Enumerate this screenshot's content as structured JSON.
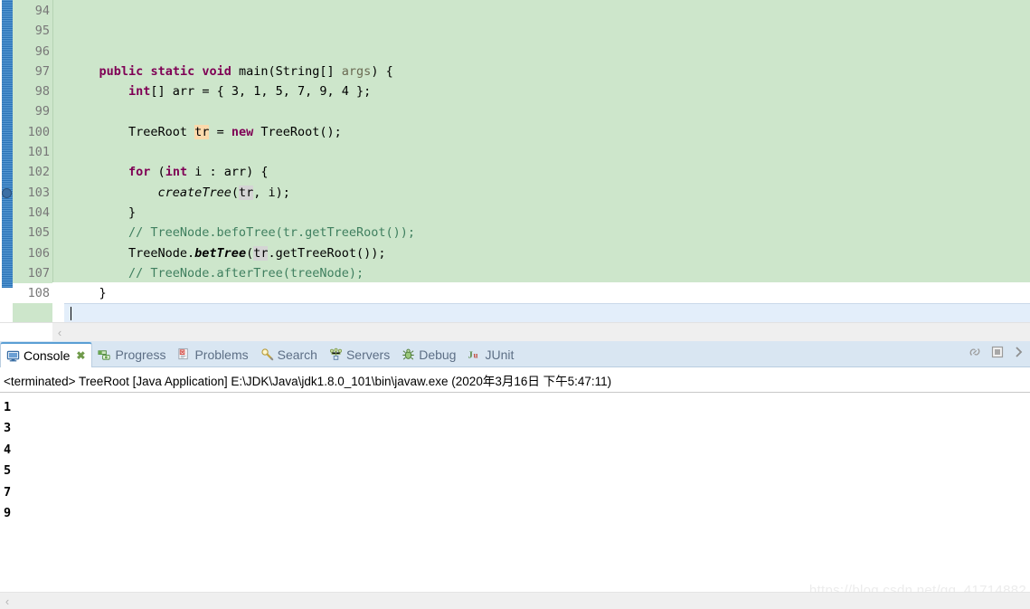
{
  "editor": {
    "first_visible_line": 94,
    "current_line": 106,
    "breakpoint_line": 103,
    "fold_marker_line": 94,
    "lines": [
      {
        "num": "94",
        "segments": [
          {
            "t": "    ",
            "c": ""
          },
          {
            "t": "public",
            "c": "kw"
          },
          {
            "t": " ",
            "c": ""
          },
          {
            "t": "static",
            "c": "kw"
          },
          {
            "t": " ",
            "c": ""
          },
          {
            "t": "void",
            "c": "kw"
          },
          {
            "t": " main(String[] ",
            "c": ""
          },
          {
            "t": "args",
            "c": "param"
          },
          {
            "t": ") {",
            "c": ""
          }
        ]
      },
      {
        "num": "95",
        "segments": [
          {
            "t": "        ",
            "c": ""
          },
          {
            "t": "int",
            "c": "kw"
          },
          {
            "t": "[] arr = { 3, 1, 5, 7, 9, 4 };",
            "c": ""
          }
        ]
      },
      {
        "num": "96",
        "segments": []
      },
      {
        "num": "97",
        "segments": [
          {
            "t": "        TreeRoot ",
            "c": ""
          },
          {
            "t": "tr",
            "c": "occ-write"
          },
          {
            "t": " = ",
            "c": ""
          },
          {
            "t": "new",
            "c": "kw"
          },
          {
            "t": " TreeRoot();",
            "c": ""
          }
        ]
      },
      {
        "num": "98",
        "segments": []
      },
      {
        "num": "99",
        "segments": [
          {
            "t": "        ",
            "c": ""
          },
          {
            "t": "for",
            "c": "kw"
          },
          {
            "t": " (",
            "c": ""
          },
          {
            "t": "int",
            "c": "kw"
          },
          {
            "t": " i : arr) {",
            "c": ""
          }
        ]
      },
      {
        "num": "100",
        "segments": [
          {
            "t": "            ",
            "c": ""
          },
          {
            "t": "createTree",
            "c": "stat-m"
          },
          {
            "t": "(",
            "c": ""
          },
          {
            "t": "tr",
            "c": "occ-read"
          },
          {
            "t": ", i);",
            "c": ""
          }
        ]
      },
      {
        "num": "101",
        "segments": [
          {
            "t": "        }",
            "c": ""
          }
        ]
      },
      {
        "num": "102",
        "segments": [
          {
            "t": "        // TreeNode.befoTree(tr.getTreeRoot());",
            "c": "cmt"
          }
        ]
      },
      {
        "num": "103",
        "segments": [
          {
            "t": "        TreeNode.",
            "c": ""
          },
          {
            "t": "betTree",
            "c": "stat-mb"
          },
          {
            "t": "(",
            "c": ""
          },
          {
            "t": "tr",
            "c": "occ-read"
          },
          {
            "t": ".getTreeRoot());",
            "c": ""
          }
        ]
      },
      {
        "num": "104",
        "segments": [
          {
            "t": "        // TreeNode.afterTree(treeNode);",
            "c": "cmt"
          }
        ]
      },
      {
        "num": "105",
        "segments": [
          {
            "t": "    }",
            "c": ""
          }
        ]
      },
      {
        "num": "106",
        "segments": [],
        "current": true
      },
      {
        "num": "107",
        "segments": [
          {
            "t": "}",
            "c": ""
          }
        ]
      },
      {
        "num": "108",
        "segments": [],
        "tail": true
      }
    ],
    "scroll_left_arrow": "‹"
  },
  "console_view": {
    "tabs": [
      {
        "label": "Console",
        "icon": "console-icon",
        "active": true,
        "close": "✖"
      },
      {
        "label": "Progress",
        "icon": "progress-icon",
        "active": false
      },
      {
        "label": "Problems",
        "icon": "problems-icon",
        "active": false
      },
      {
        "label": "Search",
        "icon": "search-icon",
        "active": false
      },
      {
        "label": "Servers",
        "icon": "servers-icon",
        "active": false
      },
      {
        "label": "Debug",
        "icon": "debug-icon",
        "active": false
      },
      {
        "label": "JUnit",
        "icon": "junit-icon",
        "active": false
      }
    ],
    "toolbar": [
      {
        "name": "pin-console-icon"
      },
      {
        "name": "terminate-icon"
      },
      {
        "name": "view-menu-chevron-icon"
      }
    ],
    "header_line": "<terminated> TreeRoot [Java Application] E:\\JDK\\Java\\jdk1.8.0_101\\bin\\javaw.exe (2020年3月16日 下午5:47:11)",
    "output_lines": [
      "1",
      "3",
      "4",
      "5",
      "7",
      "9"
    ],
    "scroll_left_arrow": "‹"
  },
  "watermark": "https://blog.csdn.net/qq_41714882",
  "colors": {
    "editor_background": "#cde6cb",
    "current_line": "#e3eefa",
    "keyword": "#7f0055",
    "comment": "#3f7f5f",
    "parameter": "#6a6a52",
    "occurrence_read": "#d4d4d4",
    "occurrence_write": "#fbd9ab",
    "tabbar_background": "#d9e6f2",
    "active_tab_border": "#5a9fd4"
  }
}
